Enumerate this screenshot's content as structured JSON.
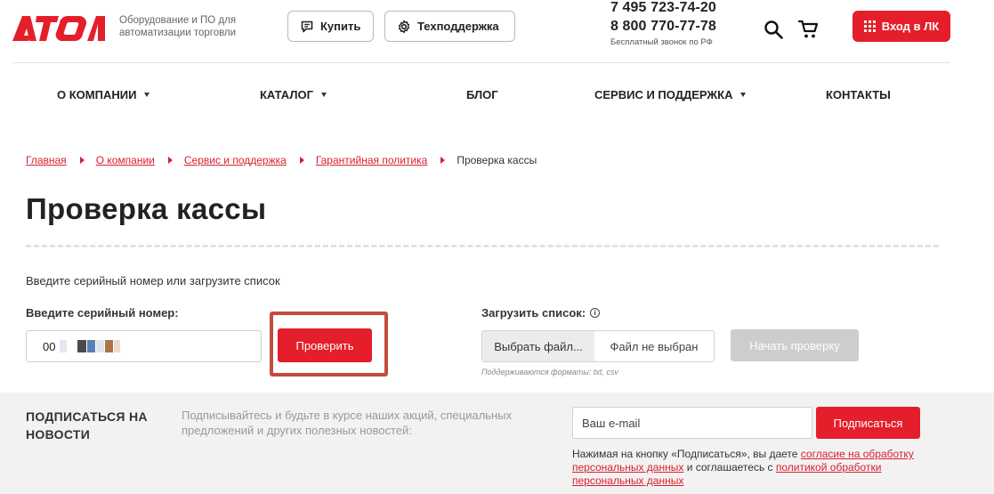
{
  "brand": {
    "logo_text": "АТОЛ",
    "tagline": "Оборудование и ПО для автоматизации торговли",
    "color": "#e51e2b"
  },
  "header": {
    "buy_label": "Купить",
    "support_label": "Техподдержка",
    "phone1": "7 495 723-74-20",
    "phone2": "8 800 770-77-78",
    "phone_note": "Бесплатный звонок по РФ",
    "login_label": "Вход в ЛК",
    "icons": [
      "chat-icon",
      "gear-icon",
      "search-icon",
      "cart-icon",
      "grid-icon"
    ]
  },
  "nav": {
    "items": [
      {
        "label": "О КОМПАНИИ",
        "dropdown": true
      },
      {
        "label": "КАТАЛОГ",
        "dropdown": true
      },
      {
        "label": "БЛОГ",
        "dropdown": false
      },
      {
        "label": "СЕРВИС И ПОДДЕРЖКА",
        "dropdown": true
      },
      {
        "label": "КОНТАКТЫ",
        "dropdown": false
      }
    ]
  },
  "breadcrumb": {
    "items": [
      "Главная",
      "О компании",
      "Сервис и поддержка",
      "Гарантийная политика"
    ],
    "current": "Проверка кассы"
  },
  "page": {
    "title": "Проверка кассы",
    "intro": "Введите серийный номер или загрузите список"
  },
  "form": {
    "serial_label": "Введите серийный номер:",
    "serial_value": "00",
    "check_button": "Проверить",
    "upload_label": "Загрузить список:",
    "file_button": "Выбрать файл...",
    "file_status": "Файл не выбран",
    "formats_note": "Поддерживаются форматы: txt, csv",
    "start_button": "Начать проверку"
  },
  "subscribe": {
    "title": "ПОДПИСАТЬСЯ НА НОВОСТИ",
    "text": "Подписывайтесь и будьте в курсе наших акций, специальных предложений и других полезных новостей:",
    "email_placeholder": "Ваш e-mail",
    "button": "Подписаться",
    "consent_prefix": "Нажимая на кнопку «Подписаться», вы даете ",
    "consent_link1": "согласие на обработку персональных данных",
    "consent_middle": " и соглашаетесь с ",
    "consent_link2": "политикой обработки персональных данных"
  }
}
